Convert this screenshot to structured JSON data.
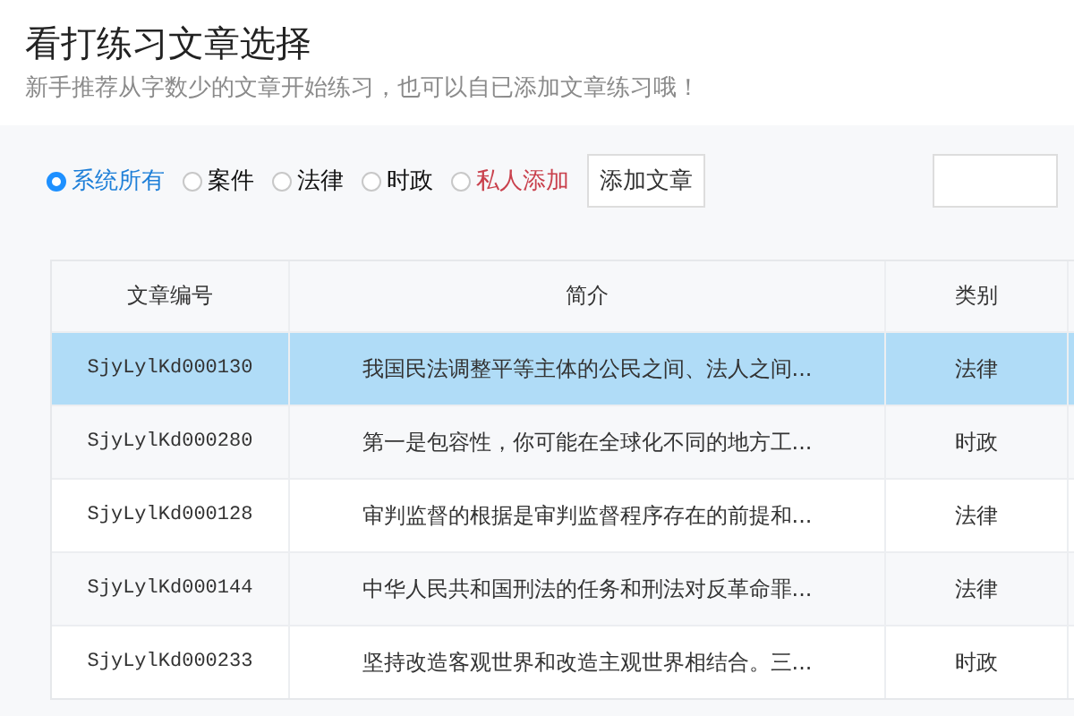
{
  "header": {
    "title": "看打练习文章选择",
    "subtitle": "新手推荐从字数少的文章开始练习，也可以自已添加文章练习哦！"
  },
  "filters": [
    {
      "label": "系统所有",
      "selected": true,
      "kind": "system"
    },
    {
      "label": "案件",
      "selected": false,
      "kind": "system"
    },
    {
      "label": "法律",
      "selected": false,
      "kind": "system"
    },
    {
      "label": "时政",
      "selected": false,
      "kind": "system"
    },
    {
      "label": "私人添加",
      "selected": false,
      "kind": "private"
    }
  ],
  "add_button": "添加文章",
  "table": {
    "columns": [
      "文章编号",
      "简介",
      "类别"
    ],
    "rows": [
      {
        "id": "SjyLylKd000130",
        "intro": "我国民法调整平等主体的公民之间、法人之间...",
        "category": "法律",
        "selected": true
      },
      {
        "id": "SjyLylKd000280",
        "intro": "第一是包容性，你可能在全球化不同的地方工...",
        "category": "时政",
        "selected": false
      },
      {
        "id": "SjyLylKd000128",
        "intro": "审判监督的根据是审判监督程序存在的前提和...",
        "category": "法律",
        "selected": false
      },
      {
        "id": "SjyLylKd000144",
        "intro": "中华人民共和国刑法的任务和刑法对反革命罪...",
        "category": "法律",
        "selected": false
      },
      {
        "id": "SjyLylKd000233",
        "intro": "坚持改造客观世界和改造主观世界相结合。三...",
        "category": "时政",
        "selected": false
      }
    ]
  }
}
